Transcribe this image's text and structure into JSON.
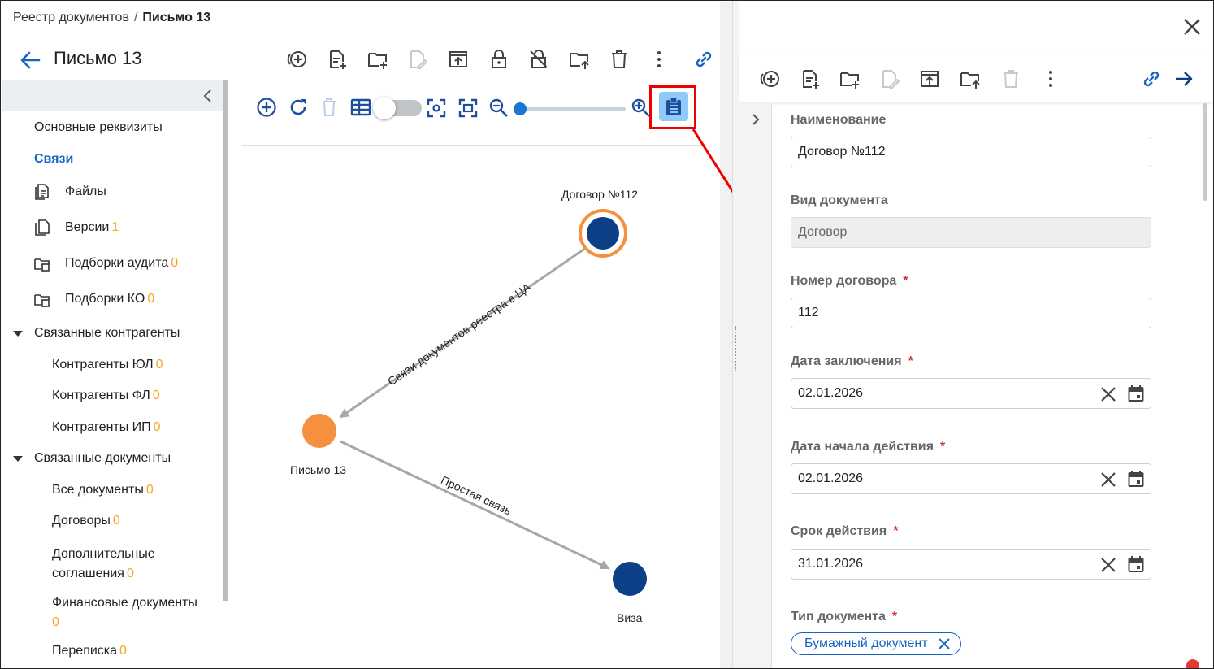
{
  "breadcrumb": {
    "parent": "Реестр документов",
    "separator": "/",
    "current": "Письмо 13"
  },
  "header": {
    "title": "Письмо 13"
  },
  "sidebar": {
    "items": [
      {
        "label": "Основные реквизиты",
        "count": ""
      },
      {
        "label": "Связи",
        "count": ""
      },
      {
        "label": "Файлы",
        "count": ""
      },
      {
        "label": "Версии",
        "count": "1"
      },
      {
        "label": "Подборки аудита",
        "count": "0"
      },
      {
        "label": "Подборки КО",
        "count": "0"
      }
    ],
    "groups": [
      {
        "label": "Связанные контрагенты",
        "children": [
          {
            "label": "Контрагенты ЮЛ",
            "count": "0"
          },
          {
            "label": "Контрагенты ФЛ",
            "count": "0"
          },
          {
            "label": "Контрагенты ИП",
            "count": "0"
          }
        ]
      },
      {
        "label": "Связанные документы",
        "children": [
          {
            "label": "Все документы",
            "count": "0"
          },
          {
            "label": "Договоры",
            "count": "0"
          },
          {
            "label": "Дополнительные",
            "label2": "соглашения",
            "count": "0"
          },
          {
            "label": "Финансовые документы",
            "count": "0"
          },
          {
            "label": "Переписка",
            "count": "0"
          }
        ]
      }
    ]
  },
  "graph": {
    "nodes": [
      {
        "label": "Договор №112",
        "color": "#0d3f86",
        "ring": "#f5913e"
      },
      {
        "label": "Письмо 13",
        "color": "#f5913e"
      },
      {
        "label": "Виза",
        "color": "#0d3f86"
      }
    ],
    "edges": [
      {
        "label": "Связи документов реестра в ЦА"
      },
      {
        "label": "Простая связь"
      }
    ]
  },
  "form": {
    "fields": [
      {
        "label": "Наименование",
        "required": false,
        "value": "Договор №112"
      },
      {
        "label": "Вид документа",
        "required": false,
        "value": "Договор"
      },
      {
        "label": "Номер договора",
        "required": true,
        "value": "112"
      },
      {
        "label": "Дата заключения",
        "required": true,
        "value": "02.01.2026"
      },
      {
        "label": "Дата начала действия",
        "required": true,
        "value": "02.01.2026"
      },
      {
        "label": "Срок действия",
        "required": true,
        "value": "31.01.2026"
      },
      {
        "label": "Тип документа",
        "required": true,
        "value": ""
      }
    ],
    "required_mark": "*",
    "chip": "Бумажный документ"
  },
  "colors": {
    "accent": "#1565c0",
    "count": "#f5a623",
    "highlight": "#e00000",
    "required": "#d32f2f"
  }
}
